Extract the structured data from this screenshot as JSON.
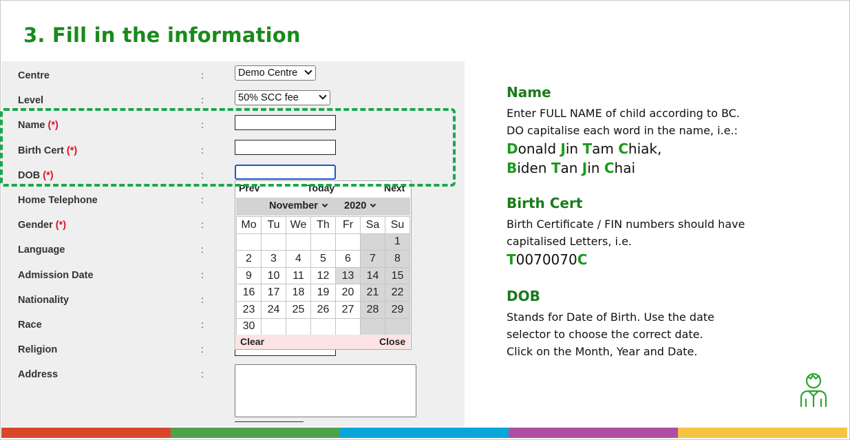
{
  "title": "3. Fill in the information",
  "form": {
    "rows": [
      {
        "label": "Centre",
        "required": false,
        "colon": ":"
      },
      {
        "label": "Level",
        "required": false,
        "colon": ":"
      },
      {
        "label": "Name",
        "required": true,
        "colon": ":"
      },
      {
        "label": "Birth Cert",
        "required": true,
        "colon": ":"
      },
      {
        "label": "DOB",
        "required": true,
        "colon": ":"
      },
      {
        "label": "Home Telephone",
        "required": false,
        "colon": ":"
      },
      {
        "label": "Gender",
        "required": true,
        "colon": ":"
      },
      {
        "label": "Language",
        "required": false,
        "colon": ":"
      },
      {
        "label": "Admission Date",
        "required": false,
        "colon": ":"
      },
      {
        "label": "Nationality",
        "required": false,
        "colon": ":"
      },
      {
        "label": "Race",
        "required": false,
        "colon": ":"
      },
      {
        "label": "Religion",
        "required": false,
        "colon": ":"
      },
      {
        "label": "Address",
        "required": false,
        "colon": ":"
      }
    ],
    "required_marker": "(*)",
    "centre_select": "Demo Centre",
    "level_select": "50% SCC fee"
  },
  "datepicker": {
    "prev": "Prev",
    "today": "Today",
    "next": "Next",
    "month": "November",
    "year": "2020",
    "weekdays": [
      "Mo",
      "Tu",
      "We",
      "Th",
      "Fr",
      "Sa",
      "Su"
    ],
    "weeks": [
      [
        "",
        "",
        "",
        "",
        "",
        "",
        "1"
      ],
      [
        "2",
        "3",
        "4",
        "5",
        "6",
        "7",
        "8"
      ],
      [
        "9",
        "10",
        "11",
        "12",
        "13",
        "14",
        "15"
      ],
      [
        "16",
        "17",
        "18",
        "19",
        "20",
        "21",
        "22"
      ],
      [
        "23",
        "24",
        "25",
        "26",
        "27",
        "28",
        "29"
      ],
      [
        "30",
        "",
        "",
        "",
        "",
        "",
        ""
      ]
    ],
    "clear": "Clear",
    "close": "Close"
  },
  "info": {
    "name": {
      "heading": "Name",
      "line1": "Enter FULL NAME of child according to BC.",
      "line2": "DO capitalise each word in the name, i.e.:",
      "ex1": [
        [
          "D",
          "onald "
        ],
        [
          "J",
          "in "
        ],
        [
          "T",
          "am "
        ],
        [
          "C",
          "hiak,"
        ]
      ],
      "ex2": [
        [
          "B",
          "iden "
        ],
        [
          "T",
          "an "
        ],
        [
          "J",
          "in "
        ],
        [
          "C",
          "hai"
        ]
      ]
    },
    "birth": {
      "heading": "Birth Cert",
      "line1": "Birth Certificate / FIN numbers should have",
      "line2": "capitalised Letters, i.e.",
      "ex": [
        [
          "T",
          "0070070"
        ],
        [
          "C",
          ""
        ]
      ]
    },
    "dob": {
      "heading": "DOB",
      "line1": "Stands for Date of Birth. Use the date",
      "line2": "selector to choose the correct date.",
      "line3": "Click on the Month, Year and Date."
    }
  },
  "colors": {
    "title_green": "#1a8a1a",
    "highlight_dash": "#1aa84a",
    "required_red": "#e0102a",
    "bar": [
      "#d9472b",
      "#4ea34a",
      "#0aa5d8",
      "#b04fa2",
      "#f6c443"
    ]
  },
  "icons": {
    "person": "person-icon"
  }
}
